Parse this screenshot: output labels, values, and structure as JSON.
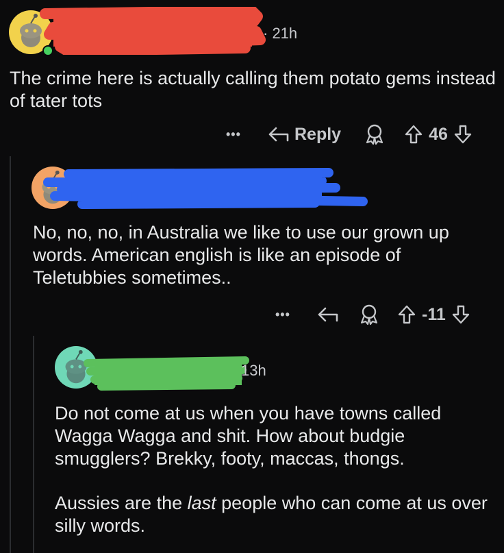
{
  "colors": {
    "background": "#0b0b0c",
    "text": "#e8e9ea",
    "muted": "#c5c7ca",
    "redact_red": "#e94b3c",
    "redact_blue": "#2f64f0",
    "redact_green": "#5cc05c"
  },
  "comments": [
    {
      "avatar_color": "#f2d24c",
      "timestamp": "· 21h",
      "body": "The crime here is actually calling them potato gems instead of tater tots",
      "actions": {
        "more": "•••",
        "reply_label": "Reply",
        "award_icon": "award-icon",
        "votes": "46"
      }
    },
    {
      "avatar_color": "#f2a365",
      "timestamp": "",
      "body": "No, no, no, in Australia we like to use our grown up words. American english is like an episode of Teletubbies sometimes..",
      "actions": {
        "more": "•••",
        "award_icon": "award-icon",
        "votes": "-11"
      }
    },
    {
      "avatar_color": "#6fd8b7",
      "timestamp": "13h",
      "body": "Do not come at us when you have towns called Wagga Wagga and shit. How about budgie smugglers? Brekky, footy, maccas, thongs.",
      "body2_before": "Aussies are the ",
      "body2_emph": "last",
      "body2_after": " people who can come at us over silly words."
    }
  ]
}
